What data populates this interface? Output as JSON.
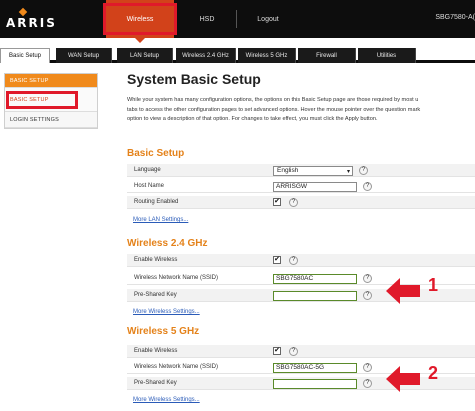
{
  "header": {
    "logo_text": "ARRIS",
    "top_tabs": [
      {
        "label": "Wireless"
      },
      {
        "label": "HSD"
      },
      {
        "label": "Logout"
      }
    ],
    "device_name": "SBG7580-A("
  },
  "tabs": [
    {
      "label": "Basic Setup"
    },
    {
      "label": "WAN Setup"
    },
    {
      "label": "LAN Setup"
    },
    {
      "label": "Wireless 2.4 GHz"
    },
    {
      "label": "Wireless 5 GHz"
    },
    {
      "label": "Firewall"
    },
    {
      "label": "Utilities"
    }
  ],
  "sidebar": {
    "items": [
      {
        "label": "BASIC SETUP"
      },
      {
        "label": "BASIC SETUP"
      },
      {
        "label": "LOGIN SETTINGS"
      }
    ]
  },
  "main": {
    "title": "System Basic Setup",
    "description": [
      "While your system has many configuration options, the options on this Basic Setup page are those required by most u",
      "tabs to access the other configuration pages to set advanced options. Hover the mouse pointer over the question mark",
      "option to view a description of that option. For changes to take effect, you must click the Apply button."
    ],
    "basic_setup": {
      "title": "Basic Setup",
      "language_label": "Language",
      "language_value": "English",
      "host_name_label": "Host Name",
      "host_name_value": "ARRISGW",
      "routing_label": "Routing Enabled",
      "routing_checked": true,
      "more_link": "More LAN Settings..."
    },
    "wireless_24": {
      "title": "Wireless 2.4 GHz",
      "enable_label": "Enable Wireless",
      "enable_checked": true,
      "ssid_label": "Wireless Network Name (SSID)",
      "ssid_value": "SBG7580AC",
      "psk_label": "Pre-Shared Key",
      "psk_value": "",
      "more_link": "More Wireless Settings..."
    },
    "wireless_5": {
      "title": "Wireless 5 GHz",
      "enable_label": "Enable Wireless",
      "enable_checked": true,
      "ssid_label": "Wireless Network Name (SSID)",
      "ssid_value": "SBG7580AC-5G",
      "psk_label": "Pre-Shared Key",
      "psk_value": "",
      "more_link": "More Wireless Settings..."
    },
    "help_glyph": "?",
    "check_glyph": "✔"
  },
  "annotations": {
    "arrow_1": "1",
    "arrow_2": "2",
    "color": "#e0192a"
  },
  "colors": {
    "accent_orange": "#e4821a",
    "active_red": "#d2421a",
    "topbar": "#0d0d0d",
    "link": "#2a5bb8"
  }
}
